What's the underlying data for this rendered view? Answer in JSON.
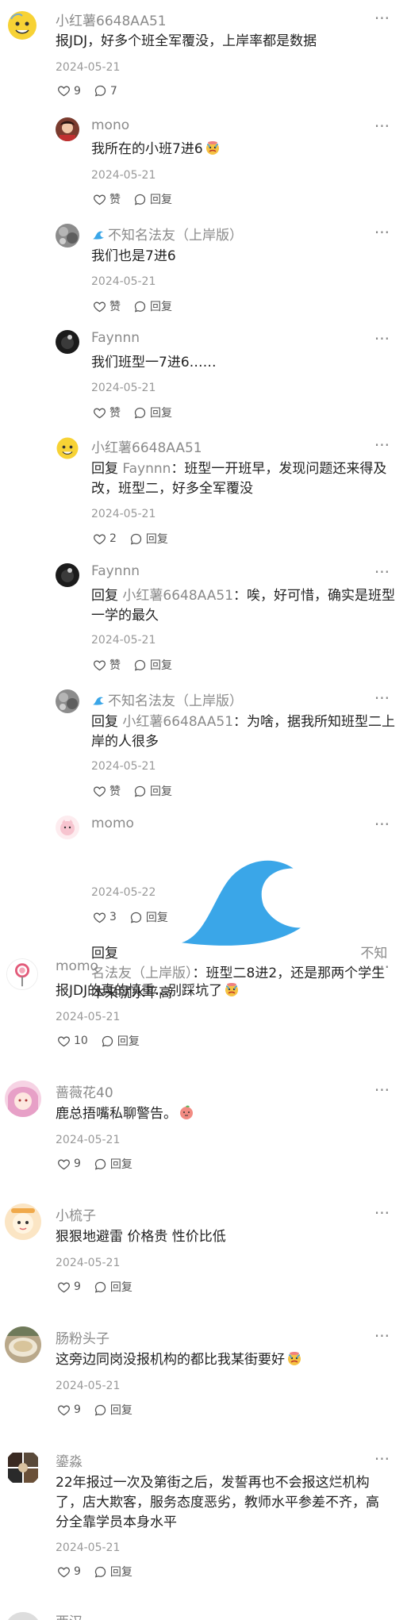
{
  "comments": [
    {
      "name": "小红薯6648AA51",
      "text": "报JDJ，好多个班全军覆没，上岸率都是数据",
      "date": "2024-05-21",
      "likes": "9",
      "replies_count": "7",
      "avatar": "yellow-emoji",
      "replies": [
        {
          "name": "mono",
          "text": "我所在的小班7进6",
          "emoji": "crying-face",
          "date": "2024-05-21",
          "likes": "赞",
          "reply_label": "回复",
          "avatar": "photo-girl"
        },
        {
          "name": "不知名法友（上岸版）",
          "badge": "wave-icon",
          "text": "我们也是7进6",
          "date": "2024-05-21",
          "likes": "赞",
          "reply_label": "回复",
          "avatar": "gray-texture"
        },
        {
          "name": "Faynnn",
          "text": "我们班型一7进6……",
          "date": "2024-05-21",
          "likes": "赞",
          "reply_label": "回复",
          "avatar": "dark-figure"
        },
        {
          "name": "小红薯6648AA51",
          "reply_prefix": "回复",
          "reply_to": "Faynnn",
          "text_after": "：班型一开班早，发现问题还来得及改，班型二，好多全军覆没",
          "line1": "回复 Faynnn：班型一开班早，发现问题还来得及",
          "line2": "改，班型二，好多全军覆没",
          "date": "2024-05-21",
          "likes": "2",
          "reply_label": "回复",
          "avatar": "yellow-emoji"
        },
        {
          "name": "Faynnn",
          "reply_prefix": "回复",
          "reply_to": "小红薯6648AA51",
          "text_after": "：唉，好可惜，确实是班型一学的最久",
          "line2": "型一学的最久",
          "date": "2024-05-21",
          "likes": "赞",
          "reply_label": "回复",
          "avatar": "dark-figure"
        },
        {
          "name": "不知名法友（上岸版）",
          "badge": "wave-icon",
          "reply_prefix": "回复",
          "reply_to": "小红薯6648AA51",
          "text_after": "：为啥，据我所知班型二上岸的人很多",
          "line2": "上岸的人很多",
          "date": "2024-05-21",
          "likes": "赞",
          "reply_label": "回复",
          "avatar": "gray-texture"
        },
        {
          "name": "momo",
          "reply_prefix": "回复",
          "reply_to": "不知名法友（上岸版）",
          "reply_to_badge": "wave-icon",
          "text_after": "：班型二8进2，还是那两个学生本来就水平高",
          "line2": "还是那两个学生本来就水平高",
          "date": "2024-05-22",
          "likes": "3",
          "reply_label": "回复",
          "avatar": "pink-cartoon"
        }
      ]
    },
    {
      "name": "momo",
      "text": "报JDJ的真的慎重…别踩坑了",
      "emoji": "crying-face",
      "date": "2024-05-21",
      "likes": "10",
      "reply_label": "回复",
      "avatar": "lollipop"
    },
    {
      "name": "蔷薇花40",
      "text": "鹿总捂嘴私聊警告。",
      "emoji": "peach",
      "date": "2024-05-21",
      "likes": "9",
      "reply_label": "回复",
      "avatar": "pink-anime"
    },
    {
      "name": "小梳子",
      "text": "狠狠地避雷 价格贵 性价比低",
      "date": "2024-05-21",
      "likes": "9",
      "reply_label": "回复",
      "avatar": "cute-sticker"
    },
    {
      "name": "肠粉头子",
      "text": "这旁边同岗没报机构的都比我某街要好",
      "emoji": "crying-face",
      "date": "2024-05-21",
      "likes": "9",
      "reply_label": "回复",
      "avatar": "food-photo"
    },
    {
      "name": "鎏淼",
      "line1": "22年报过一次及第街之后，发誓再也不会报这烂机构",
      "line2": "了，店大欺客，服务态度恶劣，教师水平参差不齐，高",
      "line3": "分全靠学员本身水平",
      "date": "2024-05-21",
      "likes": "9",
      "reply_label": "回复",
      "avatar": "dark-collage"
    },
    {
      "name": "西汉",
      "avatar": "partial"
    }
  ],
  "colors": {
    "name": "#8a8a8a",
    "text": "#222222",
    "date": "#999999",
    "icon": "#555555"
  }
}
